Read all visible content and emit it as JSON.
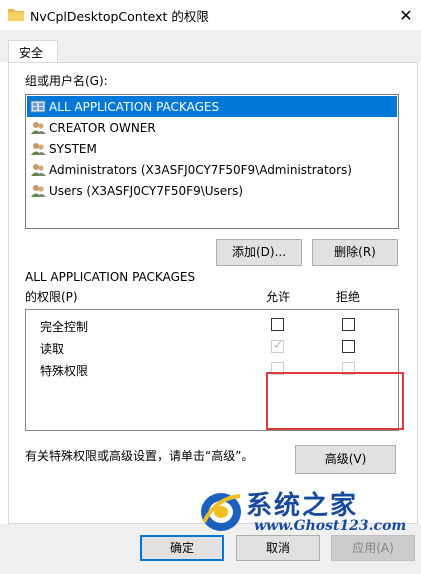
{
  "window": {
    "title": "NvCplDesktopContext 的权限",
    "close_glyph": "✕"
  },
  "tabs": [
    {
      "label": "安全",
      "active": true
    }
  ],
  "security": {
    "groups_label": "组或用户名(G):",
    "principals": [
      {
        "name": "ALL APPLICATION PACKAGES",
        "selected": true,
        "icon": "app-packages-icon"
      },
      {
        "name": "CREATOR OWNER",
        "selected": false,
        "icon": "users-icon"
      },
      {
        "name": "SYSTEM",
        "selected": false,
        "icon": "users-icon"
      },
      {
        "name": "Administrators (X3ASFJ0CY7F50F9\\Administrators)",
        "selected": false,
        "icon": "users-icon"
      },
      {
        "name": "Users (X3ASFJ0CY7F50F9\\Users)",
        "selected": false,
        "icon": "users-icon"
      }
    ],
    "add_button": "添加(D)...",
    "remove_button": "删除(R)",
    "perm_header_line1": "ALL APPLICATION PACKAGES",
    "perm_header_line2": "的权限(P)",
    "allow_label": "允许",
    "deny_label": "拒绝",
    "permissions": [
      {
        "name": "完全控制",
        "allow": false,
        "deny": false,
        "disabled": false
      },
      {
        "name": "读取",
        "allow": true,
        "deny": false,
        "disabled": false,
        "allow_inherited": true
      },
      {
        "name": "特殊权限",
        "allow": false,
        "deny": false,
        "disabled": true
      }
    ],
    "advanced_note": "有关特殊权限或高级设置，请单击“高级”。",
    "advanced_button": "高级(V)"
  },
  "footer": {
    "ok_button": "确定",
    "cancel_button": "取消",
    "apply_button": "应用(A)",
    "apply_disabled": true
  },
  "watermark": {
    "chinese": "系统之家",
    "url": "www.Ghost123.com"
  },
  "colors": {
    "selection": "#0078d7",
    "highlight_box": "#e03a3a",
    "watermark": "#174a9c"
  }
}
